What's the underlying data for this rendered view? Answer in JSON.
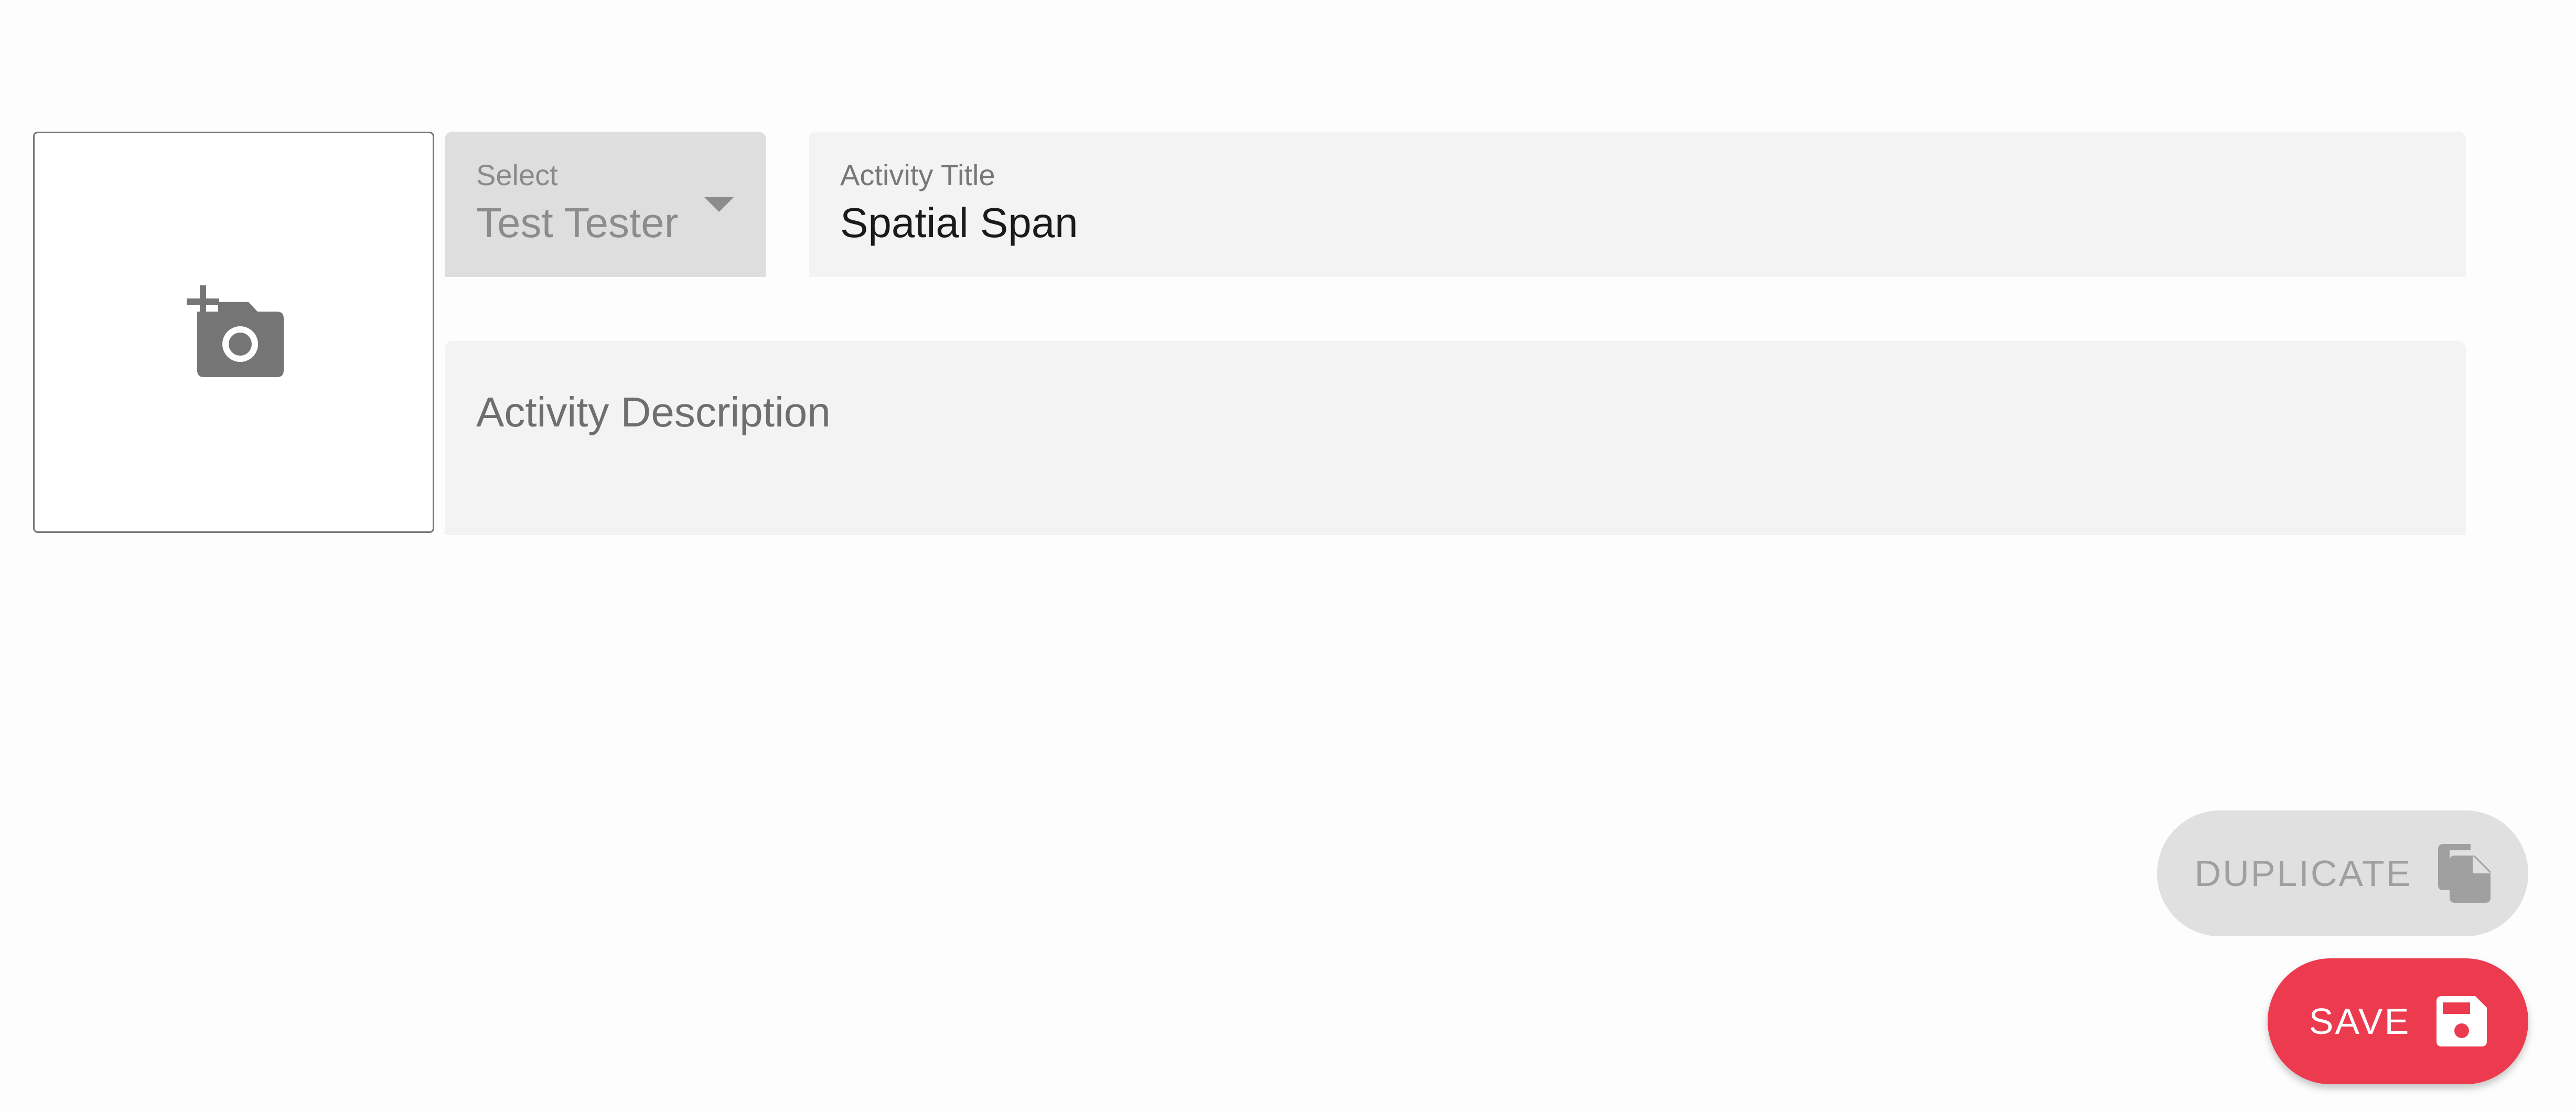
{
  "image_upload": {
    "icon": "add-a-photo-icon"
  },
  "select": {
    "label": "Select",
    "value": "Test Tester",
    "icon": "dropdown-arrow-icon"
  },
  "activity_title": {
    "label": "Activity Title",
    "value": "Spatial Span"
  },
  "activity_description": {
    "placeholder": "Activity Description",
    "value": ""
  },
  "buttons": {
    "duplicate": {
      "label": "DUPLICATE",
      "icon": "file-copy-icon",
      "disabled": true
    },
    "save": {
      "label": "SAVE",
      "icon": "save-icon"
    }
  },
  "colors": {
    "accent": "#ec3a4e",
    "field_background": "#f3f3f3",
    "disabled_background": "#e0e0e0",
    "icon_gray": "#757575"
  }
}
